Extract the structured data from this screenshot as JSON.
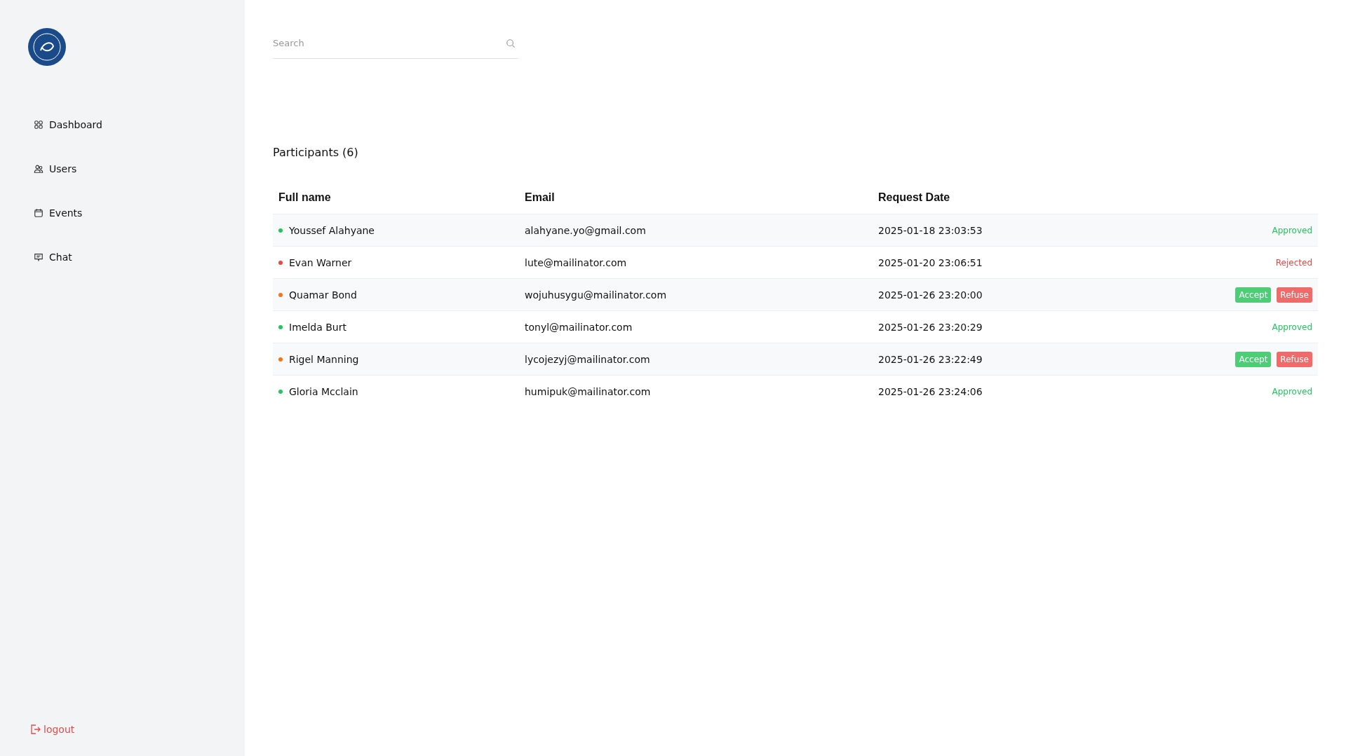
{
  "sidebar": {
    "items": [
      {
        "label": "Dashboard"
      },
      {
        "label": "Users"
      },
      {
        "label": "Events"
      },
      {
        "label": "Chat"
      }
    ],
    "logout": "logout"
  },
  "search": {
    "placeholder": "Search"
  },
  "heading": "Participants (6)",
  "table": {
    "columns": [
      "Full name",
      "Email",
      "Request Date"
    ],
    "rows": [
      {
        "name": "Youssef Alahyane",
        "color": "#22c55e",
        "email": "alahyane.yo@gmail.com",
        "date": "2025-01-18 23:03:53",
        "status": {
          "kind": "approved",
          "text": "Approved"
        }
      },
      {
        "name": "Evan Warner",
        "color": "#ef4444",
        "email": "lute@mailinator.com",
        "date": "2025-01-20 23:06:51",
        "status": {
          "kind": "rejected",
          "text": "Rejected"
        }
      },
      {
        "name": "Quamar Bond",
        "color": "#f97316",
        "email": "wojuhusygu@mailinator.com",
        "date": "2025-01-26 23:20:00",
        "status": {
          "kind": "pending",
          "accept": "Accept",
          "refuse": "Refuse"
        }
      },
      {
        "name": "Imelda Burt",
        "color": "#22c55e",
        "email": "tonyl@mailinator.com",
        "date": "2025-01-26 23:20:29",
        "status": {
          "kind": "approved",
          "text": "Approved"
        }
      },
      {
        "name": "Rigel Manning",
        "color": "#f97316",
        "email": "lycojezyj@mailinator.com",
        "date": "2025-01-26 23:22:49",
        "status": {
          "kind": "pending",
          "accept": "Accept",
          "refuse": "Refuse"
        }
      },
      {
        "name": "Gloria Mcclain",
        "color": "#22c55e",
        "email": "humipuk@mailinator.com",
        "date": "2025-01-26 23:24:06",
        "status": {
          "kind": "approved",
          "text": "Approved"
        }
      }
    ]
  }
}
